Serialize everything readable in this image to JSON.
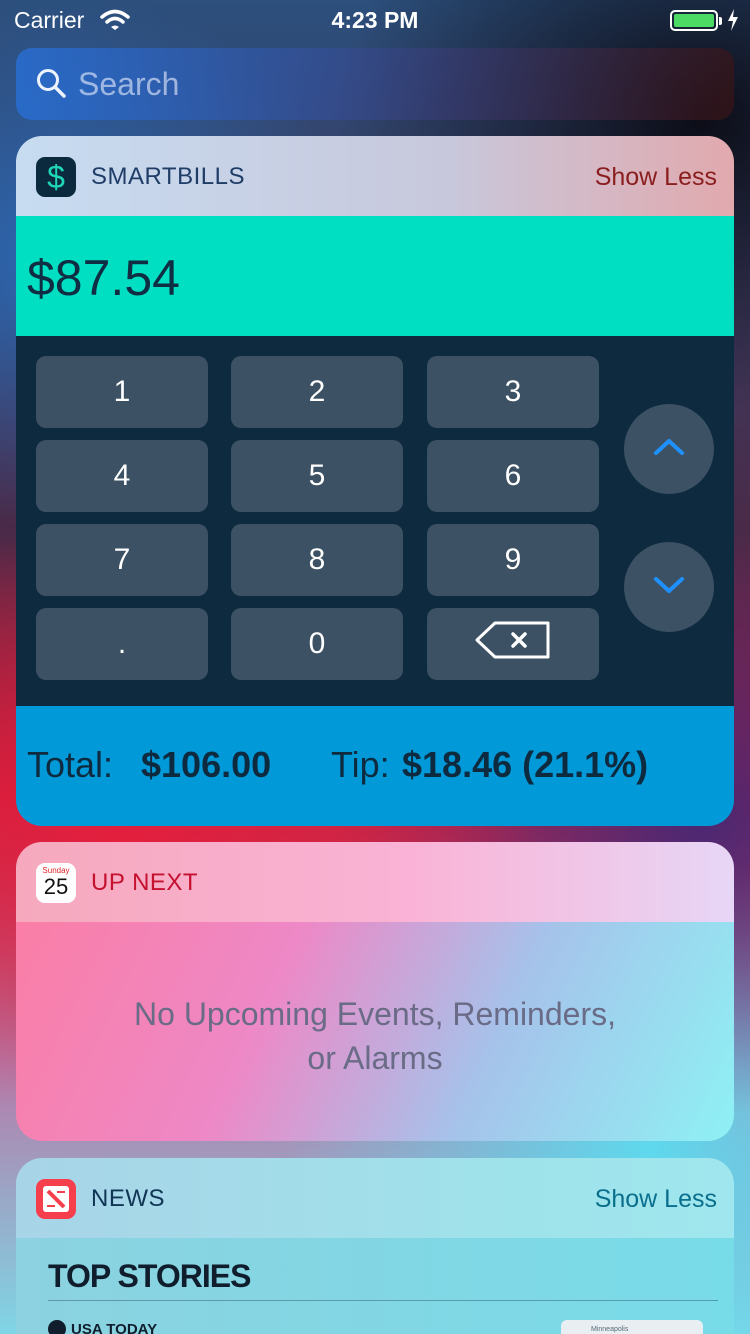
{
  "status_bar": {
    "carrier": "Carrier",
    "time": "4:23 PM"
  },
  "search": {
    "placeholder": "Search"
  },
  "smartbills": {
    "title": "SMARTBILLS",
    "action": "Show Less",
    "amount": "$87.54",
    "keys": [
      "1",
      "2",
      "3",
      "4",
      "5",
      "6",
      "7",
      "8",
      "9",
      ".",
      "0"
    ],
    "total_label": "Total:",
    "total_value": "$106.00",
    "tip_label": "Tip:",
    "tip_value": "$18.46 (21.1%)",
    "colors": {
      "amount_bg": "#00dfc1",
      "keypad_bg": "#0d2a3f",
      "totals_bg": "#0199d8",
      "arrow": "#1e90ff"
    }
  },
  "up_next": {
    "title": "UP NEXT",
    "calendar_day": "Sunday",
    "calendar_date": "25",
    "message_line1": "No Upcoming Events, Reminders,",
    "message_line2": "or Alarms"
  },
  "news": {
    "title": "NEWS",
    "action": "Show Less",
    "section": "TOP STORIES",
    "publisher": "USA TODAY",
    "thumbnail_label": "Minneapolis"
  }
}
